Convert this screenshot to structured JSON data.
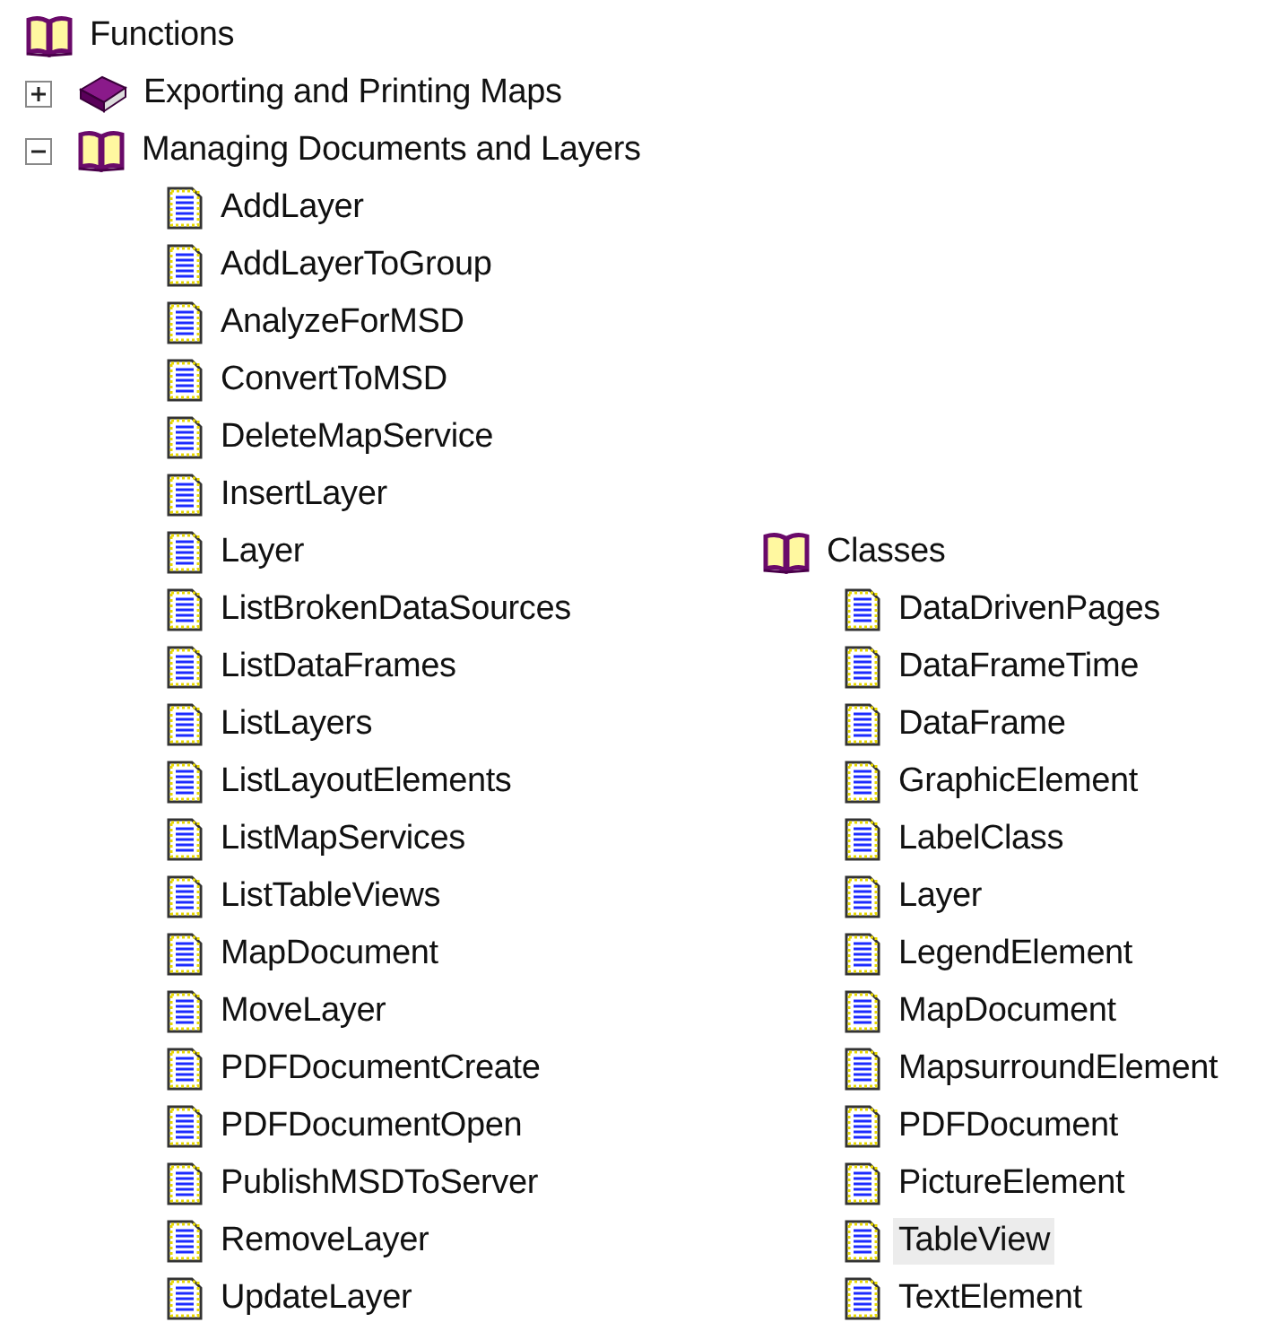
{
  "trees": [
    {
      "label": "Functions",
      "selected": false,
      "children": [
        {
          "label": "Exporting and Printing Maps",
          "expanded": false,
          "selected": false
        },
        {
          "label": "Managing Documents and Layers",
          "expanded": true,
          "selected": false,
          "children": [
            {
              "label": "AddLayer",
              "selected": false
            },
            {
              "label": "AddLayerToGroup",
              "selected": false
            },
            {
              "label": "AnalyzeForMSD",
              "selected": false
            },
            {
              "label": "ConvertToMSD",
              "selected": false
            },
            {
              "label": "DeleteMapService",
              "selected": false
            },
            {
              "label": "InsertLayer",
              "selected": false
            },
            {
              "label": "Layer",
              "selected": false
            },
            {
              "label": "ListBrokenDataSources",
              "selected": false
            },
            {
              "label": "ListDataFrames",
              "selected": false
            },
            {
              "label": "ListLayers",
              "selected": false
            },
            {
              "label": "ListLayoutElements",
              "selected": false
            },
            {
              "label": "ListMapServices",
              "selected": false
            },
            {
              "label": "ListTableViews",
              "selected": false
            },
            {
              "label": "MapDocument",
              "selected": false
            },
            {
              "label": "MoveLayer",
              "selected": false
            },
            {
              "label": "PDFDocumentCreate",
              "selected": false
            },
            {
              "label": "PDFDocumentOpen",
              "selected": false
            },
            {
              "label": "PublishMSDToServer",
              "selected": false
            },
            {
              "label": "RemoveLayer",
              "selected": false
            },
            {
              "label": "UpdateLayer",
              "selected": false
            }
          ]
        }
      ]
    },
    {
      "label": "Classes",
      "selected": false,
      "children": [
        {
          "label": "DataDrivenPages",
          "selected": false
        },
        {
          "label": "DataFrameTime",
          "selected": false
        },
        {
          "label": "DataFrame",
          "selected": false
        },
        {
          "label": "GraphicElement",
          "selected": false
        },
        {
          "label": "LabelClass",
          "selected": false
        },
        {
          "label": "Layer",
          "selected": false
        },
        {
          "label": "LegendElement",
          "selected": false
        },
        {
          "label": "MapDocument",
          "selected": false
        },
        {
          "label": "MapsurroundElement",
          "selected": false
        },
        {
          "label": "PDFDocument",
          "selected": false
        },
        {
          "label": "PictureElement",
          "selected": false
        },
        {
          "label": "TableView",
          "selected": true
        },
        {
          "label": "TextElement",
          "selected": false
        }
      ]
    }
  ]
}
